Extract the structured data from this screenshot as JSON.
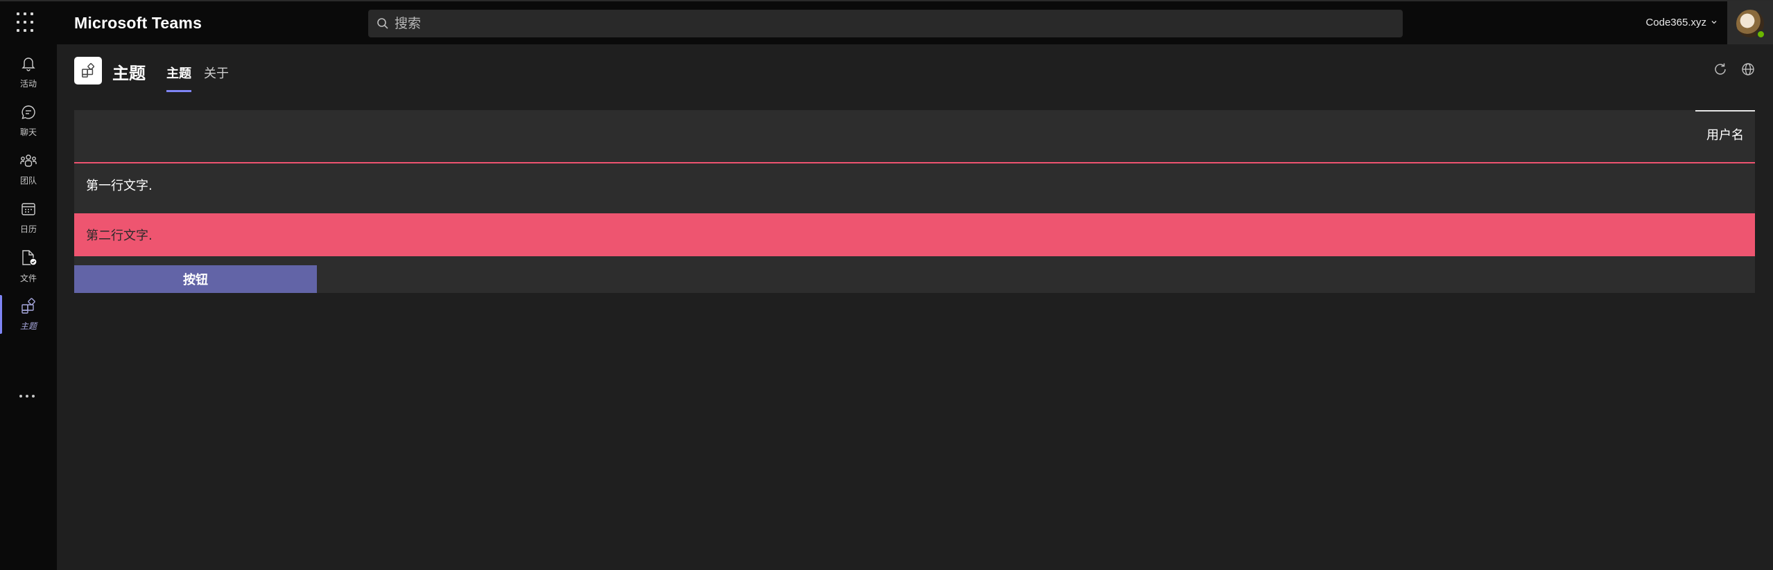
{
  "app": {
    "title": "Microsoft Teams",
    "search_placeholder": "搜索",
    "tenant": "Code365.xyz",
    "accent": "#7f85f5"
  },
  "rail": {
    "items": [
      {
        "label": "活动",
        "icon": "bell-icon"
      },
      {
        "label": "聊天",
        "icon": "chat-icon"
      },
      {
        "label": "团队",
        "icon": "teams-icon"
      },
      {
        "label": "日历",
        "icon": "calendar-icon"
      },
      {
        "label": "文件",
        "icon": "file-icon"
      },
      {
        "label": "主题",
        "icon": "apps-icon"
      }
    ],
    "active": "主题"
  },
  "header": {
    "app_name": "主题",
    "tabs": [
      {
        "label": "主题",
        "active": true
      },
      {
        "label": "关于",
        "active": false
      }
    ]
  },
  "content": {
    "header_label": "用户名",
    "row1_text": "第一行文字.",
    "row2_text": "第二行文字.",
    "button_label": "按钮",
    "highlight_color": "#ee5570",
    "button_color": "#6264a7"
  }
}
